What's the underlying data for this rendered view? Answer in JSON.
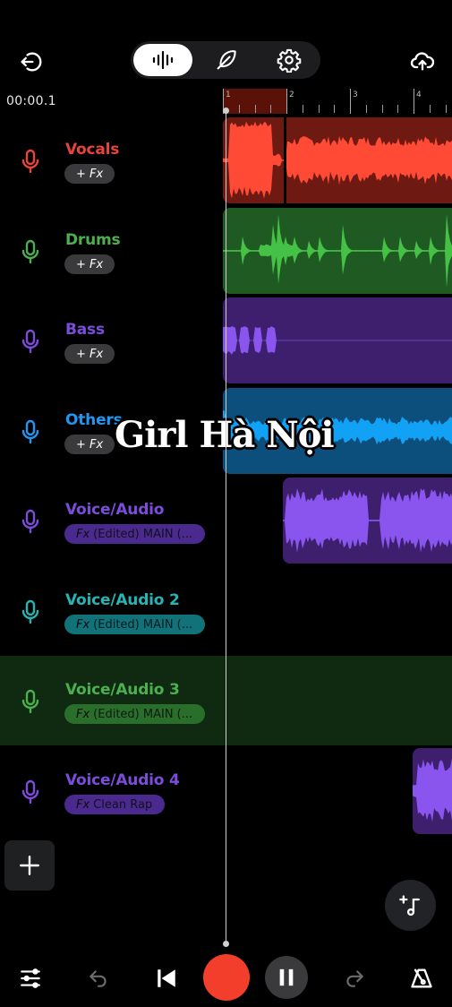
{
  "header": {
    "back_icon": "exit-arrow-icon",
    "tabs": [
      {
        "name": "waveform",
        "icon": "waveform-icon",
        "active": true
      },
      {
        "name": "lyrics",
        "icon": "feather-icon",
        "active": false
      },
      {
        "name": "settings",
        "icon": "gear-icon",
        "active": false
      }
    ],
    "upload_icon": "cloud-upload-icon"
  },
  "time_display": "00:00.1",
  "ruler": {
    "bars": [
      "1",
      "2",
      "3",
      "4"
    ],
    "loop_range": [
      "1",
      "2"
    ]
  },
  "tracks": [
    {
      "name": "Vocals",
      "color": "#e8453a",
      "fx_label": "+ Fx",
      "fx_prefix": "",
      "fx_type": "add",
      "clip_bg": "#6e1a12",
      "wave_color": "#ff4a35"
    },
    {
      "name": "Drums",
      "color": "#4caf50",
      "fx_label": "+ Fx",
      "fx_prefix": "",
      "fx_type": "add",
      "clip_bg": "#1f5a22",
      "wave_color": "#45c146"
    },
    {
      "name": "Bass",
      "color": "#7c4ddc",
      "fx_label": "+ Fx",
      "fx_prefix": "",
      "fx_type": "add",
      "clip_bg": "#3d1f6e",
      "wave_color": "#8a55ef"
    },
    {
      "name": "Others",
      "color": "#2196f3",
      "fx_label": "+ Fx",
      "fx_prefix": "",
      "fx_type": "add",
      "clip_bg": "#0d4f7c",
      "wave_color": "#12a2f5"
    },
    {
      "name": "Voice/Audio",
      "color": "#7c4ddc",
      "fx_prefix": "Fx",
      "fx_label": "(Edited) MAIN (...",
      "fx_type": "preset",
      "pill_bg": "#4a2a8e",
      "clip_bg": "#3d1f6e",
      "wave_color": "#8a55ef"
    },
    {
      "name": "Voice/Audio 2",
      "color": "#26b5b5",
      "fx_prefix": "Fx",
      "fx_label": "(Edited) MAIN (...",
      "fx_type": "preset",
      "pill_bg": "#11727a"
    },
    {
      "name": "Voice/Audio 3",
      "color": "#4caf50",
      "fx_prefix": "Fx",
      "fx_label": "(Edited) MAIN (...",
      "fx_type": "preset",
      "pill_bg": "#2a6e2c",
      "selected": true
    },
    {
      "name": "Voice/Audio 4",
      "color": "#7c4ddc",
      "fx_prefix": "Fx",
      "fx_label": "Clean Rap",
      "fx_type": "preset",
      "pill_bg": "#4a2a8e",
      "clip_bg": "#3d1f6e",
      "wave_color": "#8a55ef"
    }
  ],
  "overlay_caption": "Girl Hà Nội",
  "controls": {
    "add_track_icon": "plus-icon",
    "add_music_icon": "add-music-note-icon",
    "mixer_icon": "sliders-icon",
    "undo_icon": "undo-icon",
    "rewind_icon": "skip-to-start-icon",
    "record_icon": "record-icon",
    "pause_icon": "pause-icon",
    "redo_icon": "redo-icon",
    "metronome_icon": "metronome-icon"
  },
  "colors": {
    "record": "#f33e2b",
    "selected_row": "#0f2a10"
  }
}
